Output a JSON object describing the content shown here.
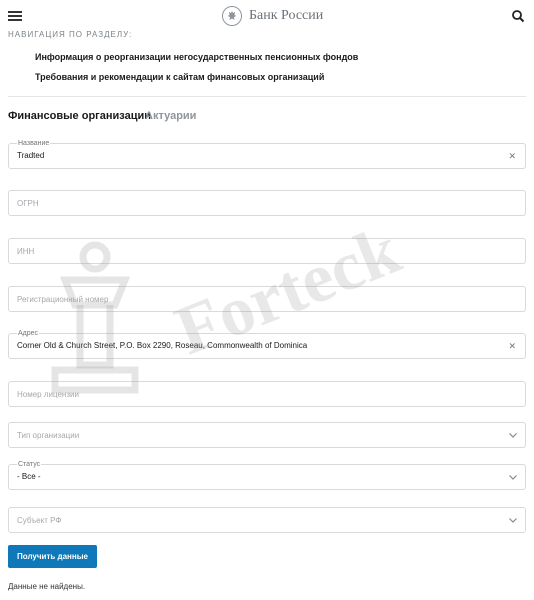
{
  "header": {
    "bank_name": "Банк России"
  },
  "navigation": {
    "title": "НАВИГАЦИЯ ПО РАЗДЕЛУ:",
    "links": [
      {
        "label": "Информация о реорганизации негосударственных пенсионных фондов"
      },
      {
        "label": "Требования и рекомендации к сайтам финансовых организаций"
      }
    ]
  },
  "tabs": [
    {
      "label": "Финансовые организации",
      "active": true
    },
    {
      "label": "Актуарии",
      "active": false
    }
  ],
  "form": {
    "name": {
      "label": "Название",
      "value": "Tradted"
    },
    "ogrn": {
      "placeholder": "ОГРН"
    },
    "inn": {
      "placeholder": "ИНН"
    },
    "reg_number": {
      "placeholder": "Регистрационный номер"
    },
    "address": {
      "label": "Адрес",
      "value": "Corner Old & Church Street, P.O. Box 2290, Roseau, Commonwealth of Dominica"
    },
    "license_number": {
      "placeholder": "Номер лицензии"
    },
    "org_type": {
      "placeholder": "Тип организации"
    },
    "status": {
      "label": "Статус",
      "value": "- Все -"
    },
    "subject": {
      "placeholder": "Субъект РФ"
    },
    "submit_label": "Получить данные"
  },
  "result_text": "Данные не найдены.",
  "watermark": {
    "text": "Forteck"
  },
  "icons": {
    "menu": "hamburger-menu-icon",
    "emblem": "bank-emblem-icon",
    "search": "search-icon",
    "clear": "close-icon",
    "dropdown": "chevron-down-icon"
  },
  "colors": {
    "accent": "#0f78b8",
    "text": "#1a1a1a",
    "muted": "#8f959a",
    "border": "#d7dadd"
  }
}
